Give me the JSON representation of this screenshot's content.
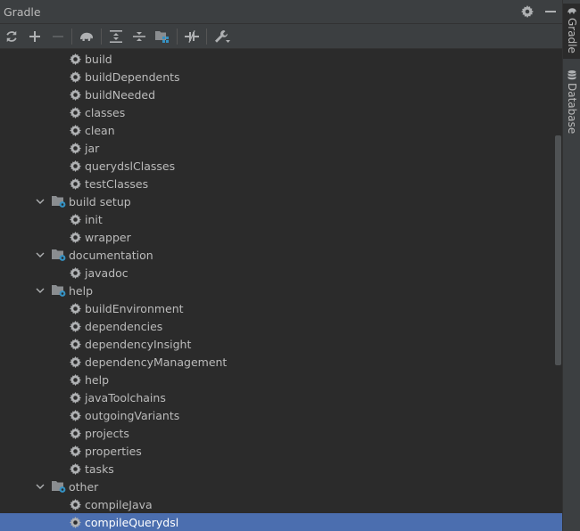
{
  "panel": {
    "title": "Gradle"
  },
  "toolbar": {
    "buttons": [
      "refresh-icon",
      "add-icon",
      "remove-icon",
      "elephant-icon",
      "expand-all-icon",
      "collapse-all-icon",
      "group-modules-icon",
      "toggle-offline-icon",
      "wrench-icon"
    ]
  },
  "tree": [
    {
      "label": "build",
      "kind": "task",
      "level": 2
    },
    {
      "label": "buildDependents",
      "kind": "task",
      "level": 2
    },
    {
      "label": "buildNeeded",
      "kind": "task",
      "level": 2
    },
    {
      "label": "classes",
      "kind": "task",
      "level": 2
    },
    {
      "label": "clean",
      "kind": "task",
      "level": 2
    },
    {
      "label": "jar",
      "kind": "task",
      "level": 2
    },
    {
      "label": "querydslClasses",
      "kind": "task",
      "level": 2
    },
    {
      "label": "testClasses",
      "kind": "task",
      "level": 2
    },
    {
      "label": "build setup",
      "kind": "group",
      "level": 1
    },
    {
      "label": "init",
      "kind": "task",
      "level": 2
    },
    {
      "label": "wrapper",
      "kind": "task",
      "level": 2
    },
    {
      "label": "documentation",
      "kind": "group",
      "level": 1
    },
    {
      "label": "javadoc",
      "kind": "task",
      "level": 2
    },
    {
      "label": "help",
      "kind": "group",
      "level": 1
    },
    {
      "label": "buildEnvironment",
      "kind": "task",
      "level": 2
    },
    {
      "label": "dependencies",
      "kind": "task",
      "level": 2
    },
    {
      "label": "dependencyInsight",
      "kind": "task",
      "level": 2
    },
    {
      "label": "dependencyManagement",
      "kind": "task",
      "level": 2
    },
    {
      "label": "help",
      "kind": "task",
      "level": 2
    },
    {
      "label": "javaToolchains",
      "kind": "task",
      "level": 2
    },
    {
      "label": "outgoingVariants",
      "kind": "task",
      "level": 2
    },
    {
      "label": "projects",
      "kind": "task",
      "level": 2
    },
    {
      "label": "properties",
      "kind": "task",
      "level": 2
    },
    {
      "label": "tasks",
      "kind": "task",
      "level": 2
    },
    {
      "label": "other",
      "kind": "group",
      "level": 1
    },
    {
      "label": "compileJava",
      "kind": "task",
      "level": 2
    },
    {
      "label": "compileQuerydsl",
      "kind": "task",
      "level": 2,
      "selected": true
    }
  ],
  "sidebar": {
    "tabs": [
      {
        "label": "Gradle",
        "icon": "elephant-icon",
        "active": true
      },
      {
        "label": "Database",
        "icon": "database-icon",
        "active": false
      }
    ]
  },
  "colors": {
    "background": "#2b2b2b",
    "toolbar": "#3c3f41",
    "selection": "#4b6eaf",
    "text": "#bbbbbb",
    "folder_badge": "#3592c4"
  }
}
